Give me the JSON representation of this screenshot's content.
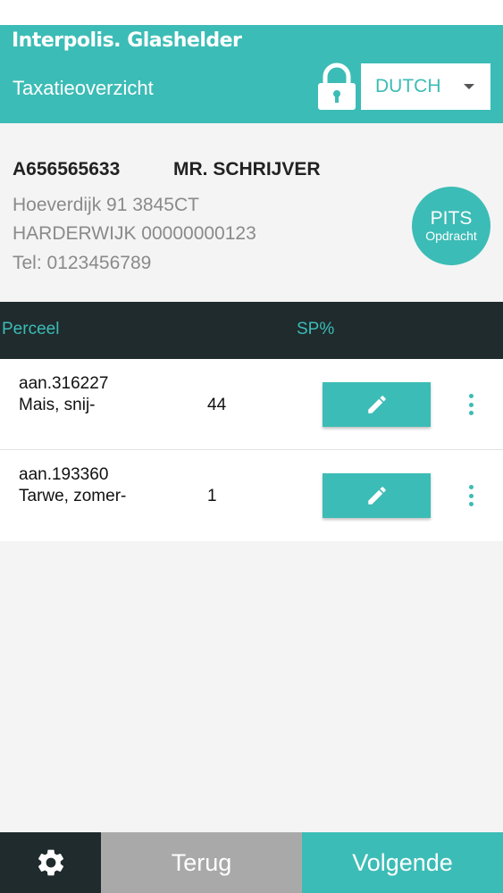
{
  "header": {
    "brand": "Interpolis. Glashelder",
    "subtitle": "Taxatieoverzicht",
    "language": "DUTCH"
  },
  "client": {
    "claim_id": "A656565633",
    "name": "MR. SCHRIJVER",
    "address_line1": "Hoeverdijk 91 3845CT",
    "address_line2": "HARDERWIJK 00000000123",
    "phone": "Tel: 0123456789"
  },
  "pits": {
    "label": "PITS",
    "sublabel": "Opdracht"
  },
  "table": {
    "col_perceel": "Perceel",
    "col_sp": "SP%",
    "rows": [
      {
        "code": "aan.316227",
        "crop": "Mais, snij-",
        "sp": "44"
      },
      {
        "code": "aan.193360",
        "crop": "Tarwe, zomer-",
        "sp": "1"
      }
    ]
  },
  "footer": {
    "back_label": "Terug",
    "next_label": "Volgende"
  },
  "colors": {
    "accent": "#3cbcb6",
    "dark": "#1f2b2d",
    "muted": "#a9a9a9"
  },
  "icons": [
    "lock-icon",
    "chevron-down-icon",
    "pencil-icon",
    "more-vertical-icon",
    "gear-icon"
  ]
}
